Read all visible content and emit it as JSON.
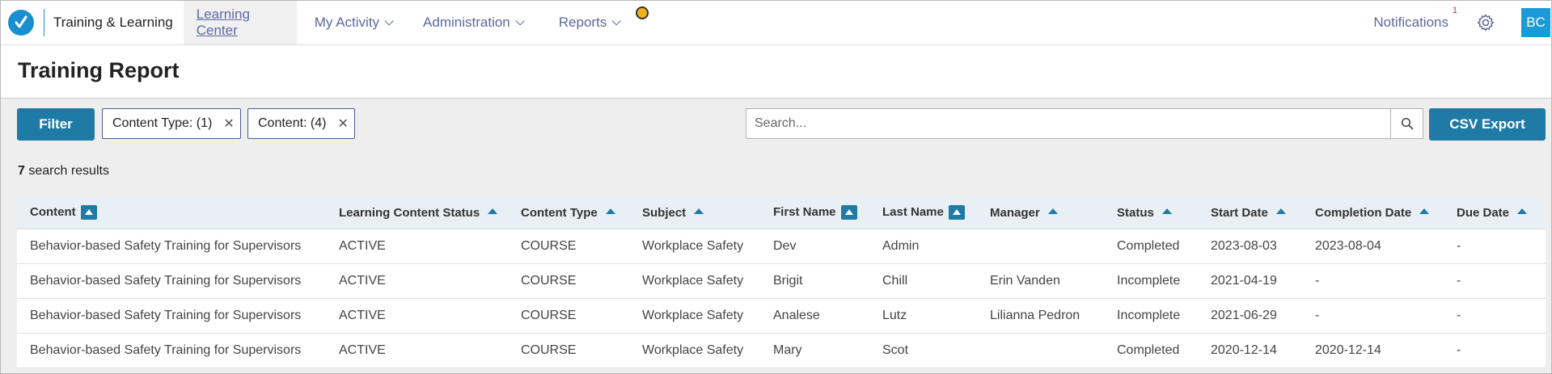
{
  "nav": {
    "app_title": "Training & Learning",
    "tabs": [
      {
        "label": "Learning Center",
        "active": true
      },
      {
        "label": "My Activity",
        "has_dropdown": true
      },
      {
        "label": "Administration",
        "has_dropdown": true
      },
      {
        "label": "Reports",
        "has_dropdown": true
      }
    ],
    "notifications_label": "Notifications",
    "notifications_count": "1",
    "avatar_initials": "BC"
  },
  "page": {
    "title": "Training Report"
  },
  "toolbar": {
    "filter_label": "Filter",
    "chips": [
      {
        "label": "Content Type: (1)"
      },
      {
        "label": "Content: (4)"
      }
    ],
    "search_placeholder": "Search...",
    "search_value": "",
    "csv_label": "CSV Export"
  },
  "results": {
    "count": "7",
    "suffix": "search results"
  },
  "table": {
    "columns": [
      {
        "label": "Content",
        "sort": "box"
      },
      {
        "label": "Learning Content Status",
        "sort": "tri"
      },
      {
        "label": "Content Type",
        "sort": "tri"
      },
      {
        "label": "Subject",
        "sort": "tri"
      },
      {
        "label": "First Name",
        "sort": "box"
      },
      {
        "label": "Last Name",
        "sort": "box"
      },
      {
        "label": "Manager",
        "sort": "tri"
      },
      {
        "label": "Status",
        "sort": "tri"
      },
      {
        "label": "Start Date",
        "sort": "tri"
      },
      {
        "label": "Completion Date",
        "sort": "tri"
      },
      {
        "label": "Due Date",
        "sort": "tri"
      }
    ],
    "rows": [
      {
        "content": "Behavior-based Safety Training for Supervisors",
        "lc_status": "ACTIVE",
        "content_type": "COURSE",
        "subject": "Workplace Safety",
        "first_name": "Dev",
        "last_name": "Admin",
        "manager": "",
        "status": "Completed",
        "start_date": "2023-08-03",
        "completion_date": "2023-08-04",
        "due_date": "-"
      },
      {
        "content": "Behavior-based Safety Training for Supervisors",
        "lc_status": "ACTIVE",
        "content_type": "COURSE",
        "subject": "Workplace Safety",
        "first_name": "Brigit",
        "last_name": "Chill",
        "manager": "Erin Vanden",
        "status": "Incomplete",
        "start_date": "2021-04-19",
        "completion_date": "-",
        "due_date": "-"
      },
      {
        "content": "Behavior-based Safety Training for Supervisors",
        "lc_status": "ACTIVE",
        "content_type": "COURSE",
        "subject": "Workplace Safety",
        "first_name": "Analese",
        "last_name": "Lutz",
        "manager": "Lilianna Pedron",
        "status": "Incomplete",
        "start_date": "2021-06-29",
        "completion_date": "-",
        "due_date": "-"
      },
      {
        "content": "Behavior-based Safety Training for Supervisors",
        "lc_status": "ACTIVE",
        "content_type": "COURSE",
        "subject": "Workplace Safety",
        "first_name": "Mary",
        "last_name": "Scot",
        "manager": "",
        "status": "Completed",
        "start_date": "2020-12-14",
        "completion_date": "2020-12-14",
        "due_date": "-"
      }
    ]
  },
  "colors": {
    "primary": "#1f7ba6",
    "logo": "#1a8fd0",
    "avatar": "#1a9bd7",
    "completed": "#3a9a3a",
    "incomplete": "#b0162b",
    "nav_link": "#5a6a9a"
  },
  "icons": {
    "logo": "checkmark-logo-icon",
    "gear": "gear-icon",
    "search": "search-icon",
    "chip_remove": "close-icon",
    "dropdown": "chevron-down-icon"
  }
}
